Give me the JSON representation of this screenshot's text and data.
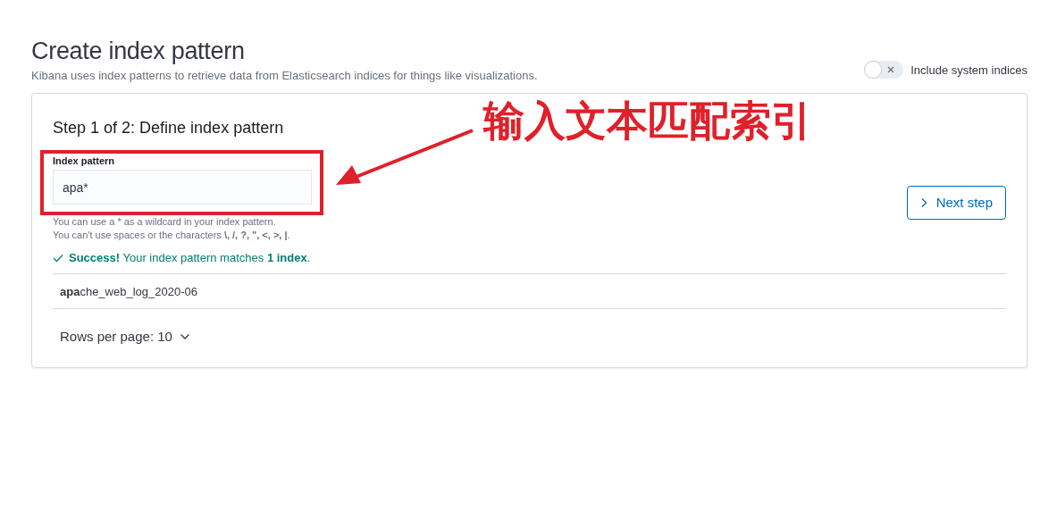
{
  "page": {
    "title": "Create index pattern",
    "description": "Kibana uses index patterns to retrieve data from Elasticsearch indices for things like visualizations."
  },
  "system_indices_toggle": {
    "label": "Include system indices",
    "on": false
  },
  "step": {
    "title": "Step 1 of 2: Define index pattern",
    "field": {
      "label": "Index pattern",
      "value": "apa*"
    },
    "help": [
      "You can use a * as a wildcard in your index pattern.",
      "You can't use spaces or the characters **\\, /, ?, \", <, >, |**."
    ],
    "status": "**Success!** Your index pattern matches **1 index**.",
    "next_button": "Next step",
    "matches": [
      "**apa**che_web_log_2020-06"
    ],
    "rows_per_page": "Rows per page: 10"
  },
  "annotation": {
    "text": "输入文本匹配索引"
  }
}
